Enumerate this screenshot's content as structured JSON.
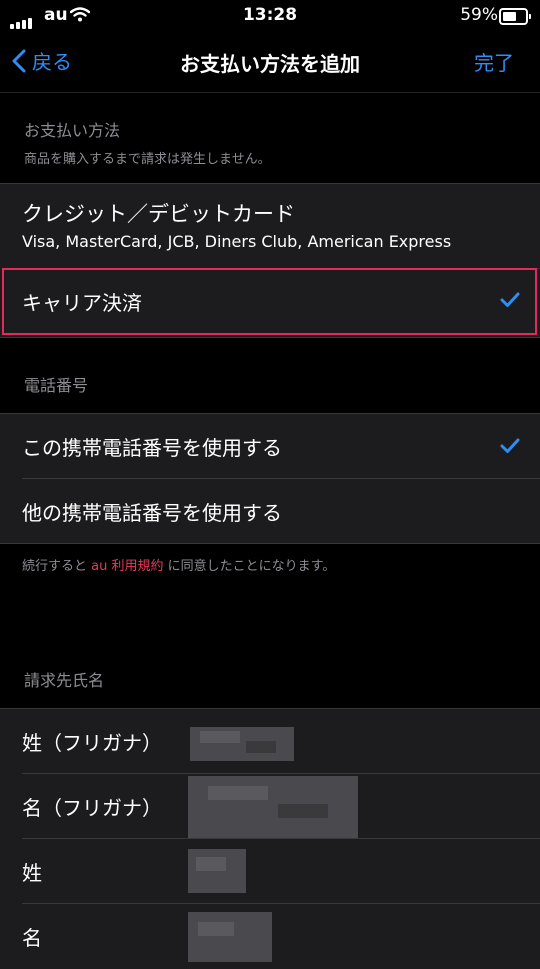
{
  "status_bar": {
    "carrier": "au",
    "time": "13:28",
    "battery_pct": "59%",
    "battery_level": 0.59
  },
  "nav": {
    "back_label": "戻る",
    "title": "お支払い方法を追加",
    "done_label": "完了"
  },
  "payment_section": {
    "header": "お支払い方法",
    "subheader": "商品を購入するまで請求は発生しません。",
    "options": [
      {
        "label": "クレジット／デビットカード",
        "detail": "Visa, MasterCard, JCB, Diners Club, American Express",
        "selected": false
      },
      {
        "label": "キャリア決済",
        "selected": true
      }
    ]
  },
  "phone_section": {
    "header": "電話番号",
    "options": [
      {
        "label": "この携帯電話番号を使用する",
        "selected": true
      },
      {
        "label": "他の携帯電話番号を使用する",
        "selected": false
      }
    ],
    "footer_prefix": "続行すると",
    "footer_link": "au 利用規約",
    "footer_suffix": "に同意したことになります。"
  },
  "billing_section": {
    "header": "請求先氏名",
    "fields": [
      {
        "label": "姓（フリガナ）"
      },
      {
        "label": "名（フリガナ）"
      },
      {
        "label": "姓"
      },
      {
        "label": "名"
      }
    ]
  },
  "colors": {
    "accent": "#2f8df6",
    "highlight": "#e4295d",
    "link": "#e8395b"
  }
}
